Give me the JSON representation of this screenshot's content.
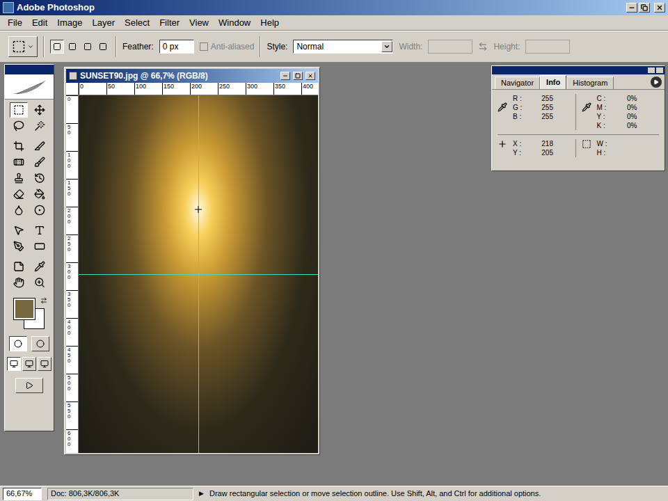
{
  "app": {
    "title": "Adobe Photoshop"
  },
  "menu": [
    "File",
    "Edit",
    "Image",
    "Layer",
    "Select",
    "Filter",
    "View",
    "Window",
    "Help"
  ],
  "options": {
    "modes": [
      {
        "selected": true
      },
      {
        "selected": false
      },
      {
        "selected": false
      },
      {
        "selected": false
      }
    ],
    "feather_label": "Feather:",
    "feather_value": "0 px",
    "anti_alias": {
      "label": "Anti-aliased",
      "checked": false,
      "disabled": true
    },
    "style_label": "Style:",
    "style_value": "Normal",
    "width": {
      "label": "Width:",
      "value": "",
      "disabled": true
    },
    "height": {
      "label": "Height:",
      "value": "",
      "disabled": true
    }
  },
  "tools": [
    {
      "selected": true
    },
    {
      "selected": false
    },
    {
      "selected": false
    },
    {
      "selected": false
    },
    {
      "selected": false
    },
    {
      "selected": false
    },
    {
      "selected": false
    },
    {
      "selected": false
    },
    {
      "selected": false
    },
    {
      "selected": false
    },
    {
      "selected": false
    },
    {
      "selected": false
    },
    {
      "selected": false
    },
    {
      "selected": false
    },
    {
      "selected": false
    },
    {
      "selected": false
    },
    {
      "selected": false
    },
    {
      "selected": false
    },
    {
      "selected": false
    },
    {
      "selected": false
    },
    {
      "selected": false
    },
    {
      "selected": false
    }
  ],
  "swatches": {
    "foreground": "#77693f",
    "background": "#ffffff"
  },
  "mask_modes": [
    {
      "selected": true
    },
    {
      "selected": false
    }
  ],
  "screen_modes": [
    {
      "selected": true
    },
    {
      "selected": false
    },
    {
      "selected": false
    }
  ],
  "document": {
    "title": "SUNSET90.jpg @ 66,7% (RGB/8)",
    "ruler_h": [
      "0",
      "50",
      "100",
      "150",
      "200",
      "250",
      "300",
      "350",
      "400"
    ],
    "ruler_v": [
      "0",
      "50",
      "100",
      "150",
      "200",
      "250",
      "300",
      "350",
      "400",
      "450",
      "500",
      "550",
      "600"
    ]
  },
  "panel": {
    "tabs": [
      {
        "label": "Navigator",
        "selected": false
      },
      {
        "label": "Info",
        "selected": true
      },
      {
        "label": "Histogram",
        "selected": false
      }
    ],
    "rgb": [
      {
        "label": "R :",
        "value": "255"
      },
      {
        "label": "G :",
        "value": "255"
      },
      {
        "label": "B :",
        "value": "255"
      }
    ],
    "cmyk": [
      {
        "label": "C :",
        "value": "0%"
      },
      {
        "label": "M :",
        "value": "0%"
      },
      {
        "label": "Y :",
        "value": "0%"
      },
      {
        "label": "K :",
        "value": "0%"
      }
    ],
    "xy": [
      {
        "label": "X :",
        "value": "218"
      },
      {
        "label": "Y :",
        "value": "205"
      }
    ],
    "wh": [
      {
        "label": "W :",
        "value": ""
      },
      {
        "label": "H :",
        "value": ""
      }
    ]
  },
  "status_bar": {
    "zoom": "66,67%",
    "doc": "Doc: 806,3K/806,3K",
    "arrow": "▶",
    "hint": "Draw rectangular selection or move selection outline. Use Shift, Alt, and Ctrl for additional options."
  }
}
